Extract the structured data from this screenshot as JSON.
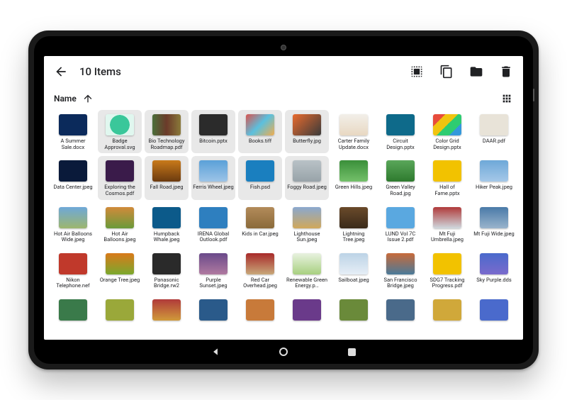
{
  "appbar": {
    "title": "10 Items"
  },
  "sort": {
    "label": "Name"
  },
  "files": [
    {
      "name": "A Summer Sale.docx",
      "selected": false,
      "thumb": "linear-gradient(#0b2a5b,#0b2a5b)"
    },
    {
      "name": "Badge Approval.svg",
      "selected": true,
      "thumb": "radial-gradient(circle at 50% 50%, #3ac79a 0 55%, #e0f7ef 56% 100%)"
    },
    {
      "name": "Bio Technology Roadmap.pdf",
      "selected": true,
      "thumb": "linear-gradient(90deg,#4b6f3a,#6b3a2a,#8a7a3a)"
    },
    {
      "name": "Bitcoin.pptx",
      "selected": true,
      "thumb": "linear-gradient(#2b2b2b,#2b2b2b)"
    },
    {
      "name": "Books.tiff",
      "selected": true,
      "thumb": "linear-gradient(135deg,#d9534f,#5bc0de,#f0ad4e)"
    },
    {
      "name": "Butterfly.jpg",
      "selected": true,
      "thumb": "linear-gradient(135deg,#e96b2e,#3a3a3a)"
    },
    {
      "name": "Carter Family Update.docx",
      "selected": false,
      "thumb": "linear-gradient(#f2efe9,#e8d8c2)"
    },
    {
      "name": "Circuit Design.pptx",
      "selected": false,
      "thumb": "linear-gradient(#0e6a8a,#0e6a8a)"
    },
    {
      "name": "Color Grid Design.pptx",
      "selected": false,
      "thumb": "multi"
    },
    {
      "name": "DAAR.pdf",
      "selected": false,
      "thumb": "linear-gradient(#e8e3d8,#e8e3d8)"
    },
    {
      "name": "Data Center.jpeg",
      "selected": false,
      "thumb": "linear-gradient(#0a1a3a,#0a1a3a)"
    },
    {
      "name": "Exploring the Cosmos.pdf",
      "selected": true,
      "thumb": "linear-gradient(#3a1b4a,#3a1b4a)"
    },
    {
      "name": "Fall Road.jpeg",
      "selected": true,
      "thumb": "linear-gradient(#c97a1a,#6b3a0f)"
    },
    {
      "name": "Ferris Wheel.jpeg",
      "selected": true,
      "thumb": "linear-gradient(#5aa0d8,#9dc4e7)"
    },
    {
      "name": "Fish.psd",
      "selected": true,
      "thumb": "linear-gradient(#1a7fbf,#1a7fbf)"
    },
    {
      "name": "Foggy Road.jpeg",
      "selected": true,
      "thumb": "linear-gradient(#b9c2c7,#98a3a9)"
    },
    {
      "name": "Green Hills.jpeg",
      "selected": false,
      "thumb": "linear-gradient(#3a8f3a,#74c06a)"
    },
    {
      "name": "Green Valley Road.jpg",
      "selected": false,
      "thumb": "linear-gradient(#5aa75a,#2e7a2e)"
    },
    {
      "name": "Hall of Fame.pptx",
      "selected": false,
      "thumb": "linear-gradient(#f2c200,#f2c200)"
    },
    {
      "name": "Hiker Peak.jpeg",
      "selected": false,
      "thumb": "linear-gradient(#6ea8d8,#a5c8e8)"
    },
    {
      "name": "Hot Air Balloons Wide.jpeg",
      "selected": false,
      "thumb": "linear-gradient(#6ea8d8,#9db66e)"
    },
    {
      "name": "Hot Air Balloons.jpeg",
      "selected": false,
      "thumb": "linear-gradient(#d18a3a,#6a9a3a)"
    },
    {
      "name": "Humpback Whale.jpeg",
      "selected": false,
      "thumb": "linear-gradient(#0c5a8a,#0c5a8a)"
    },
    {
      "name": "IRENA Global Outlook.pdf",
      "selected": false,
      "thumb": "linear-gradient(#2e7fbf,#2e7fbf)"
    },
    {
      "name": "Kids in Car.jpeg",
      "selected": false,
      "thumb": "linear-gradient(#b38b5a,#8a6a3a)"
    },
    {
      "name": "Lighthouse Sun.jpeg",
      "selected": false,
      "thumb": "linear-gradient(#8aa8cf,#d1a85a)"
    },
    {
      "name": "Lightning Tree.jpeg",
      "selected": false,
      "thumb": "linear-gradient(#6a4a2a,#3a2a1a)"
    },
    {
      "name": "LUND Vol 7C Issue 2.pdf",
      "selected": false,
      "thumb": "linear-gradient(#5aa8e0,#5aa8e0)"
    },
    {
      "name": "Mt Fuji Umbrella.jpeg",
      "selected": false,
      "thumb": "linear-gradient(#b03a3a,#cfd8de)"
    },
    {
      "name": "Mt Fuji Wide.jpeg",
      "selected": false,
      "thumb": "linear-gradient(#4a7aa8,#9ab4cc)"
    },
    {
      "name": "Nikon Telephone.nef",
      "selected": false,
      "thumb": "linear-gradient(#c0392b,#c0392b)"
    },
    {
      "name": "Orange Tree.jpeg",
      "selected": false,
      "thumb": "linear-gradient(#d97a1a,#7aa82e)"
    },
    {
      "name": "Panasonic Bridge.rw2",
      "selected": false,
      "thumb": "linear-gradient(#2a2a2a,#2a2a2a)"
    },
    {
      "name": "Purple Sunset.jpeg",
      "selected": false,
      "thumb": "linear-gradient(#6a4a8a,#b07aa0)"
    },
    {
      "name": "Red Car Overhead.jpeg",
      "selected": false,
      "thumb": "linear-gradient(#a82a2a,#c8a87a)"
    },
    {
      "name": "Renewable Green Energy.p…",
      "selected": false,
      "thumb": "linear-gradient(#e8f2e0,#a8d080)"
    },
    {
      "name": "Sailboat.jpeg",
      "selected": false,
      "thumb": "linear-gradient(#bcd3e6,#e6eef6)"
    },
    {
      "name": "San Francisco Bridge.jpeg",
      "selected": false,
      "thumb": "linear-gradient(#c86a3a,#4a7a9a)"
    },
    {
      "name": "SDG7 Tracking Progress.pdf",
      "selected": false,
      "thumb": "linear-gradient(#f2c200,#f2c200)"
    },
    {
      "name": "Sky Purple.dds",
      "selected": false,
      "thumb": "linear-gradient(#4a6acc,#7a6acc)"
    },
    {
      "name": "",
      "selected": false,
      "thumb": "linear-gradient(#3a7a4a,#3a7a4a)"
    },
    {
      "name": "",
      "selected": false,
      "thumb": "linear-gradient(#9aa83a,#9aa83a)"
    },
    {
      "name": "",
      "selected": false,
      "thumb": "linear-gradient(#b03a3a,#d09a3a)"
    },
    {
      "name": "",
      "selected": false,
      "thumb": "linear-gradient(#2a5a8a,#2a5a8a)"
    },
    {
      "name": "",
      "selected": false,
      "thumb": "linear-gradient(#c87a3a,#c87a3a)"
    },
    {
      "name": "",
      "selected": false,
      "thumb": "linear-gradient(#6a3a8a,#6a3a8a)"
    },
    {
      "name": "",
      "selected": false,
      "thumb": "linear-gradient(#6a8a3a,#6a8a3a)"
    },
    {
      "name": "",
      "selected": false,
      "thumb": "linear-gradient(#4a6a8a,#4a6a8a)"
    },
    {
      "name": "",
      "selected": false,
      "thumb": "linear-gradient(#d0a83a,#d0a83a)"
    },
    {
      "name": "",
      "selected": false,
      "thumb": "linear-gradient(#4a6acc,#4a6acc)"
    }
  ]
}
